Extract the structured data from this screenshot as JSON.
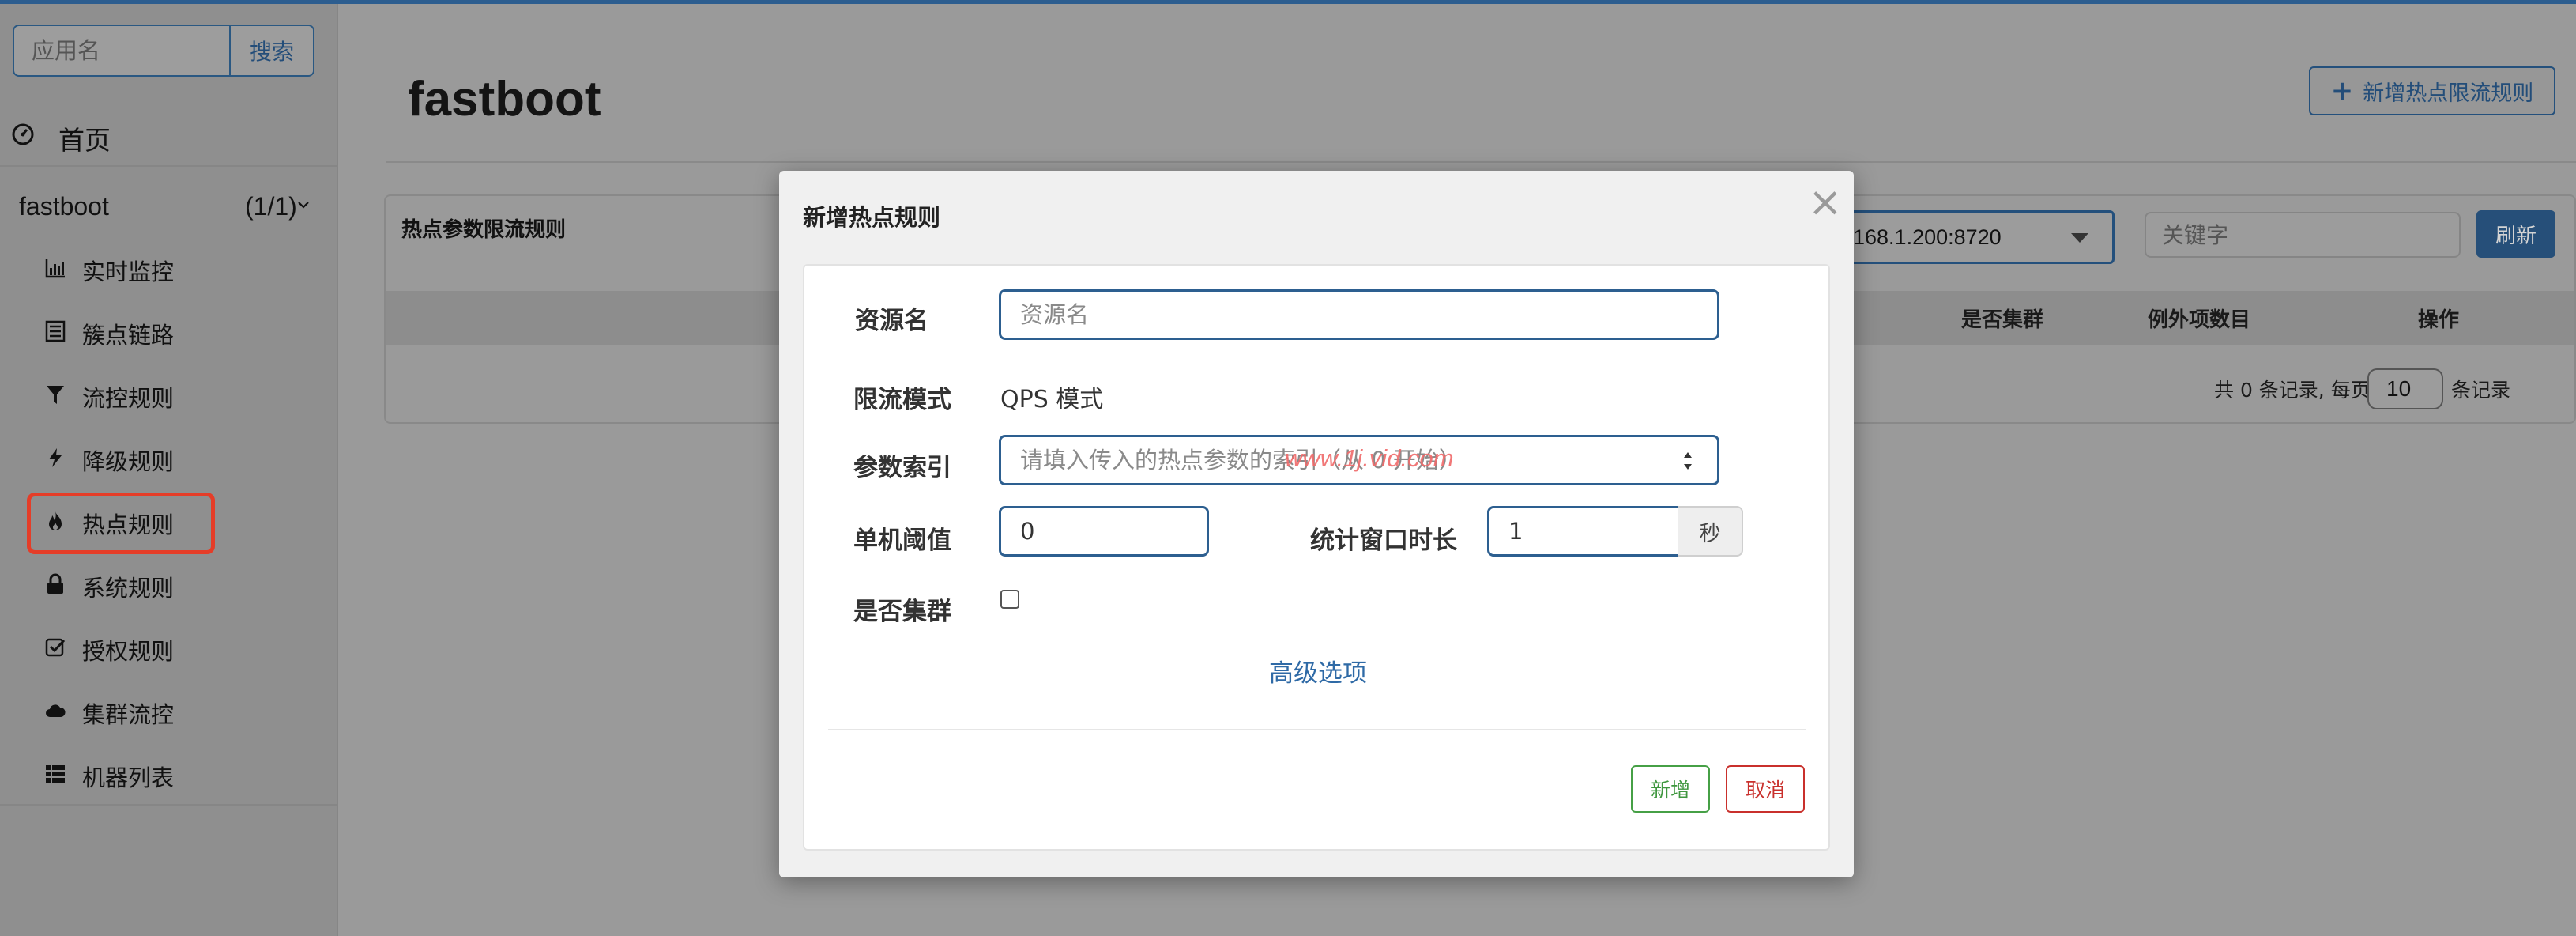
{
  "sidebar": {
    "search_placeholder": "应用名",
    "search_button": "搜索",
    "home_label": "首页",
    "app": {
      "name": "fastboot",
      "count": "(1/1)"
    },
    "menu": [
      {
        "label": "实时监控",
        "icon": "bar-chart-icon"
      },
      {
        "label": "簇点链路",
        "icon": "list-icon"
      },
      {
        "label": "流控规则",
        "icon": "filter-icon"
      },
      {
        "label": "降级规则",
        "icon": "flash-icon"
      },
      {
        "label": "热点规则",
        "icon": "fire-icon",
        "active": true
      },
      {
        "label": "系统规则",
        "icon": "lock-icon"
      },
      {
        "label": "授权规则",
        "icon": "check-icon"
      },
      {
        "label": "集群流控",
        "icon": "cloud-icon"
      },
      {
        "label": "机器列表",
        "icon": "th-list-icon"
      }
    ]
  },
  "main": {
    "title": "fastboot",
    "add_button": "新增热点限流规则",
    "panel_title": "热点参数限流规则",
    "machine_value": "168.1.200:8720",
    "keyword_placeholder": "关键字",
    "refresh_button": "刷新",
    "columns": [
      "是否集群",
      "例外项数目",
      "操作"
    ],
    "pager": {
      "prefix": "共 0 条记录, 每页",
      "size": "10",
      "suffix": "条记录"
    }
  },
  "modal": {
    "title": "新增热点规则",
    "close": "×",
    "resource_label": "资源名",
    "resource_placeholder": "资源名",
    "mode_label": "限流模式",
    "mode_value": "QPS 模式",
    "index_label": "参数索引",
    "index_placeholder": "请填入传入的热点参数的索引（从 0 开始）",
    "threshold_label": "单机阈值",
    "threshold_value": "0",
    "window_label": "统计窗口时长",
    "window_value": "1",
    "window_unit": "秒",
    "cluster_label": "是否集群",
    "advanced_link": "高级选项",
    "add_button": "新增",
    "cancel_button": "取消",
    "watermark": "www.1j.vid.com"
  },
  "colors": {
    "accent": "#2d5f90",
    "active_outline": "#e53d28",
    "add_green": "#46a046",
    "cancel_red": "#c9302c"
  }
}
